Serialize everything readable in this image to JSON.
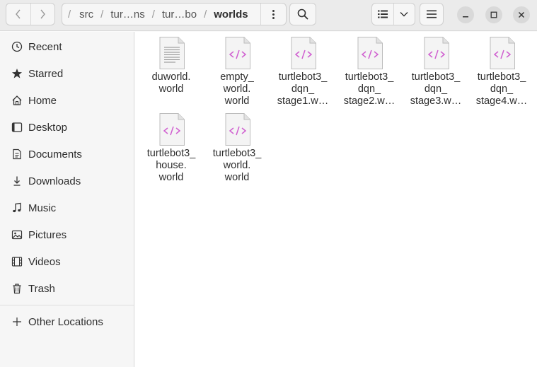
{
  "header": {
    "breadcrumbs": [
      "src",
      "tur…ns",
      "tur…bo",
      "worlds"
    ]
  },
  "sidebar": {
    "items": [
      {
        "label": "Recent",
        "icon": "clock-icon"
      },
      {
        "label": "Starred",
        "icon": "star-icon"
      },
      {
        "label": "Home",
        "icon": "home-icon"
      },
      {
        "label": "Desktop",
        "icon": "desktop-icon"
      },
      {
        "label": "Documents",
        "icon": "document-icon"
      },
      {
        "label": "Downloads",
        "icon": "download-icon"
      },
      {
        "label": "Music",
        "icon": "music-icon"
      },
      {
        "label": "Pictures",
        "icon": "picture-icon"
      },
      {
        "label": "Videos",
        "icon": "video-icon"
      },
      {
        "label": "Trash",
        "icon": "trash-icon"
      }
    ],
    "other_locations": "Other Locations"
  },
  "files": [
    {
      "name": "duworld.\nworld",
      "icon": "text-file-icon"
    },
    {
      "name": "empty_\nworld.\nworld",
      "icon": "code-file-icon"
    },
    {
      "name": "turtlebot3_\ndqn_\nstage1.w…",
      "icon": "code-file-icon"
    },
    {
      "name": "turtlebot3_\ndqn_\nstage2.w…",
      "icon": "code-file-icon"
    },
    {
      "name": "turtlebot3_\ndqn_\nstage3.w…",
      "icon": "code-file-icon"
    },
    {
      "name": "turtlebot3_\ndqn_\nstage4.w…",
      "icon": "code-file-icon"
    },
    {
      "name": "turtlebot3_\nhouse.\nworld",
      "icon": "code-file-icon"
    },
    {
      "name": "turtlebot3_\nworld.\nworld",
      "icon": "code-file-icon"
    }
  ],
  "colors": {
    "code_glyph": "#d05fd0",
    "header_bg": "#ebebeb",
    "sidebar_bg": "#f6f6f6"
  }
}
